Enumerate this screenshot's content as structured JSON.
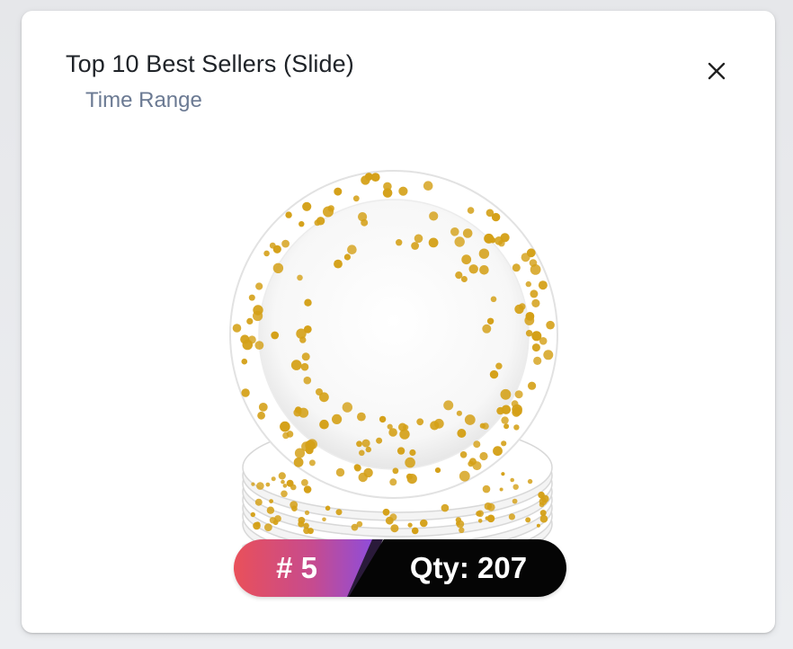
{
  "widget": {
    "title": "Top 10 Best Sellers (Slide)",
    "subtitle": "Time Range",
    "close_icon": "close-icon"
  },
  "product": {
    "image_icon": "gold-dot-paper-plates-image"
  },
  "badge": {
    "rank_label": "# 5",
    "qty_label": "Qty: 207"
  },
  "colors": {
    "accent_gold": "#d4a017",
    "rank_gradient_start": "#e9505a",
    "rank_gradient_end": "#8a4de0",
    "qty_bg": "#050505",
    "subtitle": "#6b7a93"
  }
}
